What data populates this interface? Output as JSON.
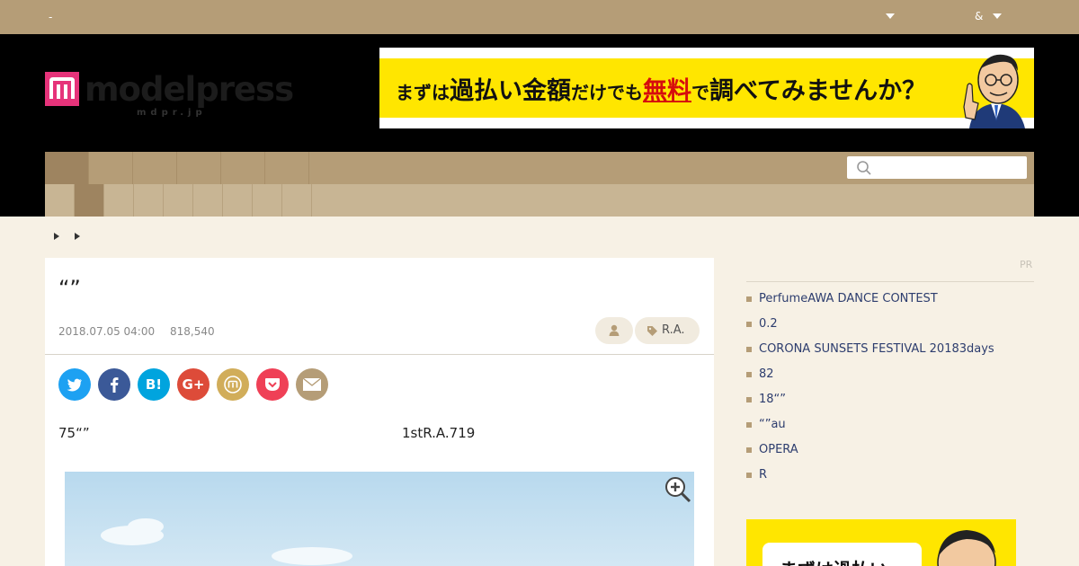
{
  "topbar": {
    "left_text": "-",
    "right_text": "&"
  },
  "logo": {
    "word": "modelpress",
    "sub": "mdpr.jp"
  },
  "ad_top": {
    "pre": "まずは",
    "big1": "過払い金額",
    "mid": "だけでも",
    "red": "無料",
    "post": "で",
    "big2": "調べて",
    "tail": "みませんか？"
  },
  "search": {
    "placeholder": ""
  },
  "article": {
    "title": "“”",
    "date": "2018.07.05 04:00",
    "views": "818,540",
    "tag": "R.A.",
    "lead_left": "75“”",
    "lead_right": "1stR.A.719"
  },
  "share": {
    "hatena": "B!",
    "gplus": "G+"
  },
  "sidebar": {
    "pr": "PR",
    "items": [
      "PerfumeAWA DANCE CONTEST",
      "0.2",
      "CORONA SUNSETS FESTIVAL 20183days",
      "82",
      "18“”",
      "“”au",
      "OPERA",
      "R"
    ]
  },
  "ad_side": {
    "text": "まずは過払い"
  },
  "colors": {
    "brand": "#b59d77",
    "accent": "#e6337a",
    "twitter": "#1da1f2",
    "facebook": "#3b5998",
    "hatena": "#00a4de",
    "gplus": "#dd4b39",
    "mixi": "#d1ad5a",
    "pocket": "#ef4056",
    "mail": "#b59d77"
  }
}
